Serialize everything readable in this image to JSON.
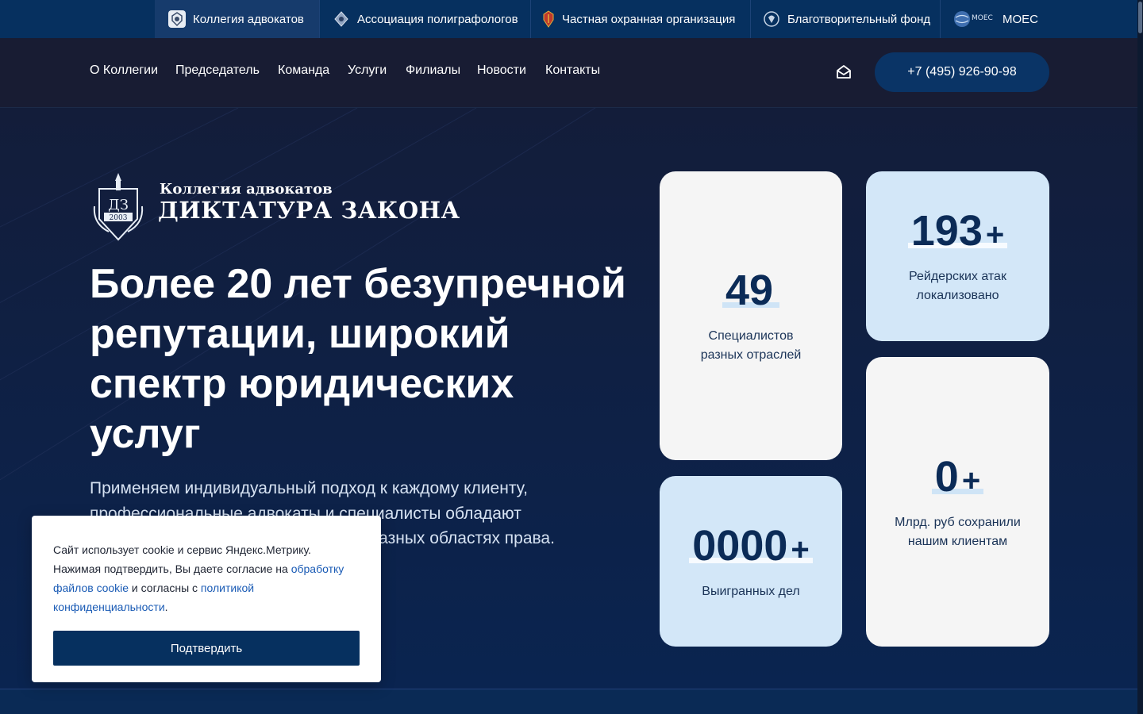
{
  "org_bar": {
    "items": [
      {
        "label": "Коллегия адвокатов",
        "icon": "college-emblem-icon",
        "active": true
      },
      {
        "label": "Ассоциация полиграфологов",
        "icon": "polygraph-association-icon",
        "active": false
      },
      {
        "label": "Частная охранная организация",
        "icon": "security-organization-icon",
        "active": false
      },
      {
        "label": "Благотворительный фонд",
        "icon": "charity-fund-icon",
        "active": false
      },
      {
        "label": "МОЕС",
        "icon": "moes-logo-icon",
        "active": false
      }
    ]
  },
  "nav": {
    "links": [
      "О Коллегии",
      "Председатель",
      "Команда",
      "Услуги",
      "Филиалы",
      "Новости",
      "Контакты"
    ],
    "mail_icon": "mail-icon",
    "phone": "+7 (495) 926-90-98"
  },
  "logo": {
    "line1": "Коллегия адвокатов",
    "line2": "ДИКТАТУРА ЗАКОНА",
    "emblem_text": "ДЗ",
    "emblem_year": "2003"
  },
  "hero": {
    "headline": "Более 20 лет безупречной репутации, широкий спектр юридических услуг",
    "subtext": "Применяем индивидуальный подход к каждому клиенту, профессиональные адвокаты и специалисты обладают многолетней успешной практикой в разных областях права. Работаем 24/7 без выходных."
  },
  "stats": [
    {
      "value": "49",
      "plus": "",
      "label": "Специалистов разных отраслей"
    },
    {
      "value": "193",
      "plus": "+",
      "label": "Рейдерских атак локализовано"
    },
    {
      "value": "0000",
      "plus": "+",
      "label": "Выигранных дел"
    },
    {
      "value": "0",
      "plus": "+",
      "label": "Млрд. руб сохранили нашим клиентам"
    }
  ],
  "cookie": {
    "text_before": "Сайт использует cookie и сервис Яндекс.Метрику. Нажимая подтвердить, Вы даете согласие на ",
    "link1": "обработку файлов cookie",
    "text_middle": " и согласны с ",
    "link2": "политикой конфиденциальности",
    "text_after": ".",
    "button": "Подтвердить"
  },
  "colors": {
    "org_bar_bg": "#06305f",
    "nav_bg": "#181c33",
    "accent_blue": "#0b2b57",
    "card_light_blue": "#d3e7f8",
    "link_color": "#1a5bb5"
  }
}
